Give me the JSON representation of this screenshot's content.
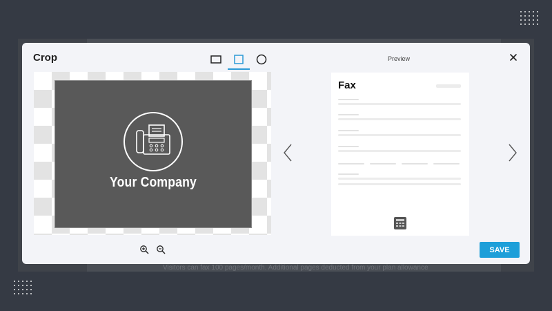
{
  "modal": {
    "title": "Crop",
    "preview_label": "Preview",
    "save_label": "SAVE"
  },
  "shapes": [
    {
      "name": "rectangle",
      "icon": "rectangle-icon",
      "active": false
    },
    {
      "name": "square",
      "icon": "square-icon",
      "active": true
    },
    {
      "name": "circle",
      "icon": "circle-icon",
      "active": false
    }
  ],
  "crop_image": {
    "company_name": "Your Company",
    "logo_icon": "fax-machine-icon"
  },
  "preview_doc": {
    "title": "Fax"
  },
  "background_page": {
    "footer_text": "Visitors can fax 100 pages/month. Additional pages deducted from your plan allowance"
  },
  "colors": {
    "accent": "#1e9fd9",
    "page_bg": "#353a44",
    "modal_bg": "#f3f4f8",
    "image_bg": "#595959"
  }
}
